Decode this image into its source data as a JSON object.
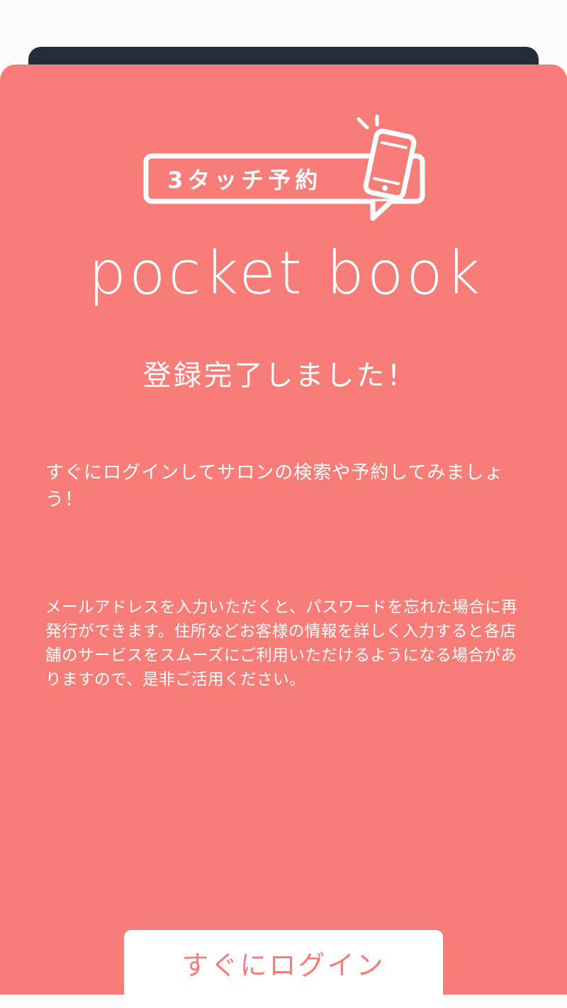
{
  "colors": {
    "background": "#FCFCFC",
    "card": "#F87C77",
    "header_sheet": "#252D38",
    "button_bg": "#FFFFFF",
    "button_text": "#F87C77",
    "text": "#FFFFFF"
  },
  "badge": {
    "text": "3タッチ予約",
    "icon": "smartphone-icon"
  },
  "brand": {
    "name": "pocket book"
  },
  "heading": "登録完了しました！",
  "lead": "すぐにログインしてサロンの検索や予約してみましょう！",
  "note": "メールアドレスを入力いただくと、パスワードを忘れた場合に再発行ができます。住所などお客様の情報を詳しく入力すると各店舗のサービスをスムーズにご利用いただけるようになる場合がありますので、是非ご活用ください。",
  "login_button": {
    "label": "すぐにログイン"
  }
}
